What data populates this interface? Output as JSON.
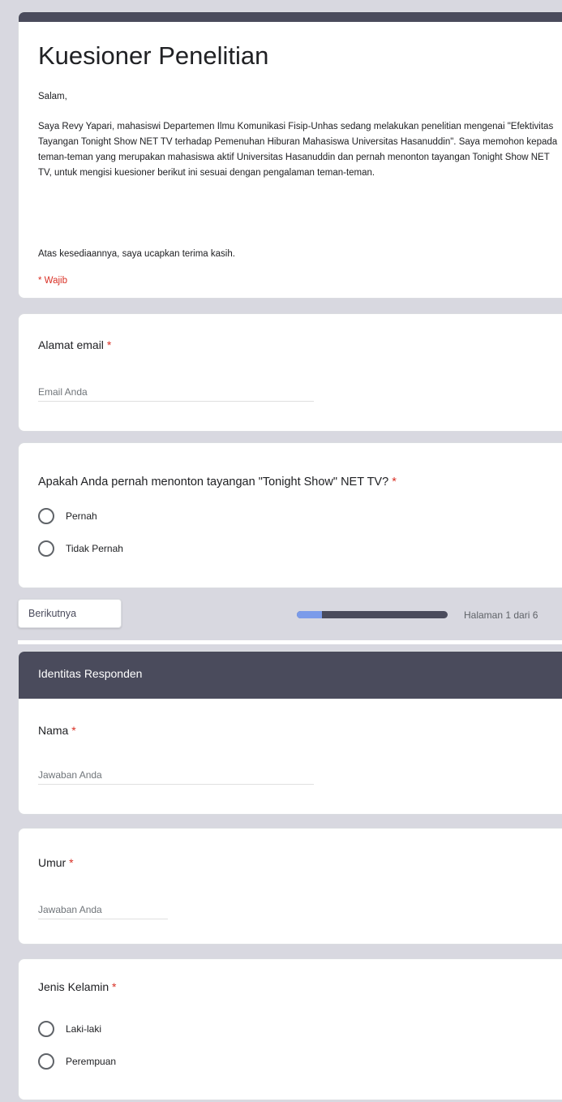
{
  "form": {
    "title": "Kuesioner Penelitian",
    "greeting": "Salam,",
    "description": "Saya Revy Yapari, mahasiswi Departemen Ilmu Komunikasi Fisip-Unhas sedang melakukan penelitian mengenai \"Efektivitas Tayangan Tonight Show NET TV terhadap Pemenuhan Hiburan Mahasiswa Universitas Hasanuddin\". Saya memohon kepada teman-teman yang merupakan mahasiswa aktif Universitas Hasanuddin dan pernah menonton tayangan Tonight Show NET TV, untuk mengisi kuesioner berikut ini sesuai dengan pengalaman teman-teman.",
    "thanks": "Atas kesediaannya, saya ucapkan terima kasih.",
    "required_note": "* Wajib"
  },
  "email_question": {
    "label": "Alamat email",
    "required_mark": "*",
    "placeholder": "Email Anda"
  },
  "watch_question": {
    "label": "Apakah Anda pernah menonton tayangan \"Tonight Show\" NET TV?",
    "required_mark": "*",
    "options": [
      "Pernah",
      "Tidak Pernah"
    ]
  },
  "navigation": {
    "next_label": "Berikutnya",
    "page_indicator": "Halaman 1 dari 6",
    "progress_fraction": 0.167
  },
  "section": {
    "title": "Identitas Responden"
  },
  "name_question": {
    "label": "Nama",
    "required_mark": "*",
    "placeholder": "Jawaban Anda"
  },
  "age_question": {
    "label": "Umur",
    "required_mark": "*",
    "placeholder": "Jawaban Anda"
  },
  "gender_question": {
    "label": "Jenis Kelamin",
    "required_mark": "*",
    "options": [
      "Laki-laki",
      "Perempuan"
    ]
  },
  "colors": {
    "theme": "#4a4b5c",
    "progress_fill": "#7b9bea",
    "required": "#d93025",
    "background": "#d8d8e0"
  }
}
